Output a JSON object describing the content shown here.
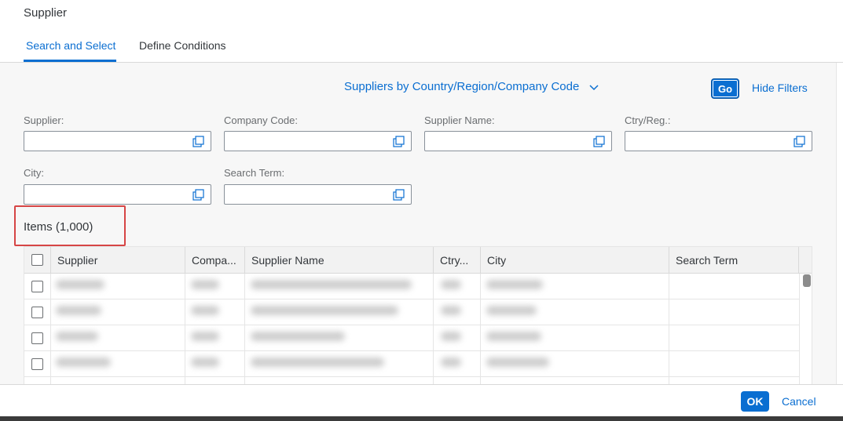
{
  "dialog": {
    "title": "Supplier",
    "tabs": [
      {
        "label": "Search and Select",
        "active": true
      },
      {
        "label": "Define Conditions",
        "active": false
      }
    ]
  },
  "filterbar": {
    "variant": "Suppliers by Country/Region/Company Code",
    "go_label": "Go",
    "hide_filters_label": "Hide Filters",
    "fields": [
      {
        "label": "Supplier:",
        "value": ""
      },
      {
        "label": "Company Code:",
        "value": ""
      },
      {
        "label": "Supplier Name:",
        "value": ""
      },
      {
        "label": "Ctry/Reg.:",
        "value": ""
      },
      {
        "label": "City:",
        "value": ""
      },
      {
        "label": "Search Term:",
        "value": ""
      }
    ]
  },
  "table": {
    "title": "Items (1,000)",
    "columns": [
      "Supplier",
      "Compa...",
      "Supplier Name",
      "Ctry...",
      "City",
      "Search Term"
    ]
  },
  "footer": {
    "ok_label": "OK",
    "cancel_label": "Cancel"
  },
  "colors": {
    "accent": "#0a6ed1",
    "highlight": "#d64545"
  },
  "icons": {
    "value_help": "value-help-icon",
    "variant_dropdown": "chevron-down-icon"
  }
}
